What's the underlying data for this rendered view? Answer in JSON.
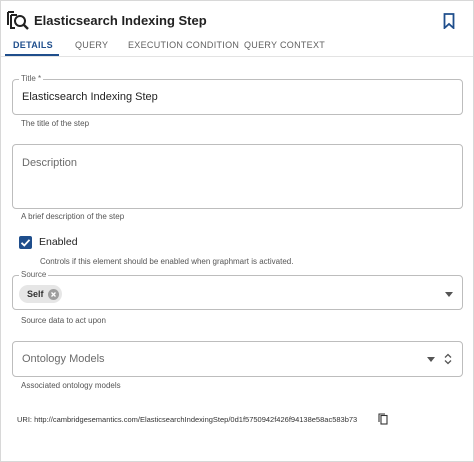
{
  "header": {
    "title": "Elasticsearch Indexing Step",
    "icons": {
      "step": "search-document-icon",
      "bookmark": "bookmark-icon"
    }
  },
  "tabs": [
    {
      "label": "DETAILS",
      "active": true
    },
    {
      "label": "QUERY",
      "active": false
    },
    {
      "label": "EXECUTION CONDITION",
      "active": false
    },
    {
      "label": "QUERY CONTEXT",
      "active": false
    }
  ],
  "form": {
    "title": {
      "label": "Title *",
      "value": "Elasticsearch Indexing Step",
      "hint": "The title of the step"
    },
    "description": {
      "placeholder": "Description",
      "value": "",
      "hint": "A brief description of the step"
    },
    "enabled": {
      "label": "Enabled",
      "checked": true,
      "hint": "Controls if this element should be enabled when graphmart is activated."
    },
    "source": {
      "label": "Source",
      "selected": "Self",
      "hint": "Source data to act upon"
    },
    "ontology_models": {
      "placeholder": "Ontology Models",
      "hint": "Associated ontology models"
    }
  },
  "uri": "URI: http://cambridgesemantics.com/ElasticsearchIndexingStep/0d1f5750942f426f94138e58ac583b73",
  "colors": {
    "accent": "#1f4e8c",
    "border": "#bdbdbd",
    "chip": "#e6e6e6"
  }
}
